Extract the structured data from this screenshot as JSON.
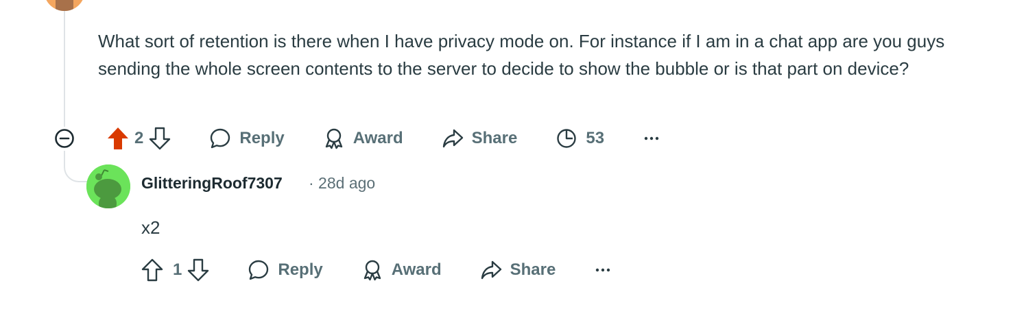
{
  "parent_comment": {
    "body": "What sort of retention is there when I have privacy mode on. For instance if I am in a chat app are you guys sending the whole screen contents to the server to decide to show the bubble or is that part on device?",
    "score": "2",
    "upvoted": true,
    "actions": {
      "reply": "Reply",
      "award": "Award",
      "share": "Share",
      "insights": "53"
    }
  },
  "reply": {
    "username": "GlitteringRoof7307",
    "meta": "· 28d ago",
    "body": "x2",
    "score": "1",
    "actions": {
      "reply": "Reply",
      "award": "Award",
      "share": "Share"
    }
  },
  "colors": {
    "upvote_active": "#d93a00",
    "action_text": "#576f76",
    "avatar_green": "#6be35a",
    "thread_line": "#dfe3e6"
  },
  "icons": [
    "collapse-icon",
    "upvote-icon",
    "downvote-icon",
    "comment-icon",
    "award-icon",
    "share-icon",
    "insights-icon",
    "more-icon"
  ]
}
